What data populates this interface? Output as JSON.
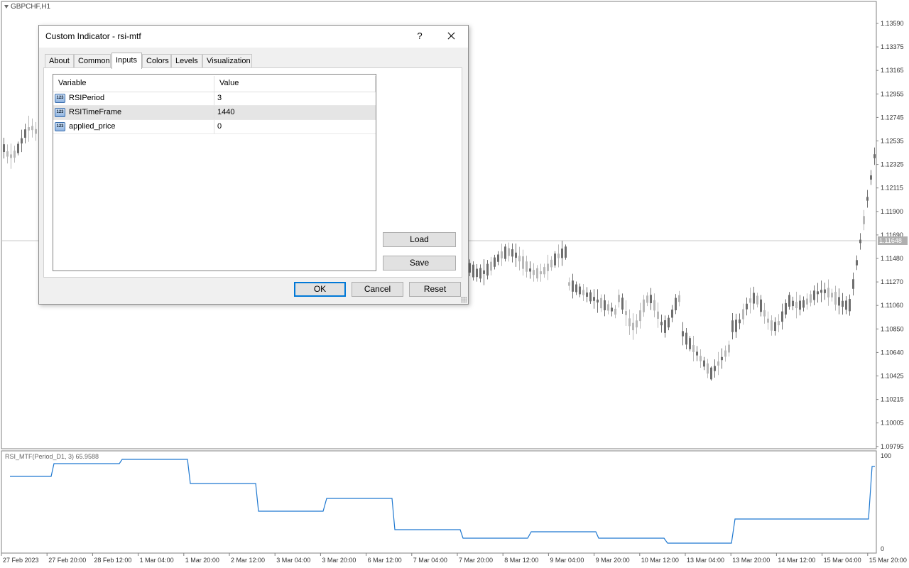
{
  "chart": {
    "symbol": "GBPCHF,H1",
    "indicator_label": "RSI_MTF(Period_D1, 3) 65.9588",
    "current_price": "1.11648",
    "price_ticks": [
      "1.13590",
      "1.13375",
      "1.13165",
      "1.12955",
      "1.12745",
      "1.12535",
      "1.12325",
      "1.12115",
      "1.11900",
      "1.11690",
      "1.11480",
      "1.11270",
      "1.11060",
      "1.10850",
      "1.10640",
      "1.10425",
      "1.10215",
      "1.10005",
      "1.09795"
    ],
    "indicator_ticks": [
      "100",
      "0"
    ],
    "time_ticks": [
      "27 Feb 2023",
      "27 Feb 20:00",
      "28 Feb 12:00",
      "1 Mar 04:00",
      "1 Mar 20:00",
      "2 Mar 12:00",
      "3 Mar 04:00",
      "3 Mar 20:00",
      "6 Mar 12:00",
      "7 Mar 04:00",
      "7 Mar 20:00",
      "8 Mar 12:00",
      "9 Mar 04:00",
      "9 Mar 20:00",
      "10 Mar 12:00",
      "13 Mar 04:00",
      "13 Mar 20:00",
      "14 Mar 12:00",
      "15 Mar 04:00",
      "15 Mar 20:00"
    ],
    "indicator_color": "#1e78d0"
  },
  "dialog": {
    "title": "Custom Indicator - rsi-mtf",
    "help_label": "?",
    "tabs": [
      {
        "label": "About"
      },
      {
        "label": "Common"
      },
      {
        "label": "Inputs"
      },
      {
        "label": "Colors"
      },
      {
        "label": "Levels"
      },
      {
        "label": "Visualization"
      }
    ],
    "active_tab": "Inputs",
    "grid": {
      "col_variable": "Variable",
      "col_value": "Value",
      "icon_text": "123",
      "rows": [
        {
          "name": "RSIPeriod",
          "value": "3"
        },
        {
          "name": "RSITimeFrame",
          "value": "1440"
        },
        {
          "name": "applied_price",
          "value": "0"
        }
      ]
    },
    "buttons": {
      "load": "Load",
      "save": "Save",
      "ok": "OK",
      "cancel": "Cancel",
      "reset": "Reset"
    }
  }
}
